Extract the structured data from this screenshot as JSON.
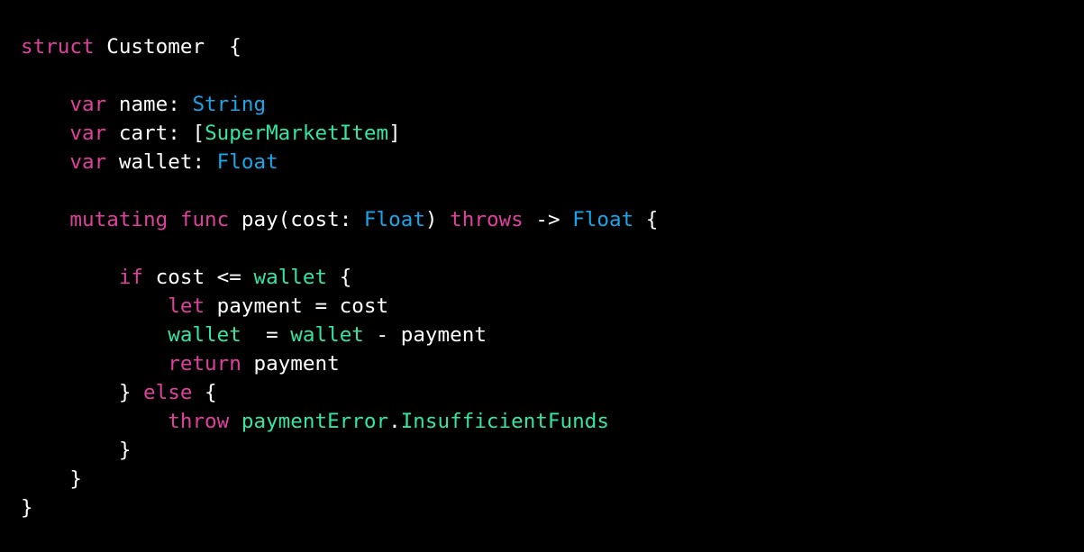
{
  "colors": {
    "keyword": "#e0409d",
    "type": "#17a6ea",
    "identifier": "#33e6a3",
    "plain": "#ffffff",
    "background": "#000000"
  },
  "code": {
    "lines": [
      [
        {
          "t": "struct",
          "c": "kw"
        },
        {
          "t": " Customer  {",
          "c": "plain"
        }
      ],
      [],
      [
        {
          "t": "    ",
          "c": "plain"
        },
        {
          "t": "var",
          "c": "kw"
        },
        {
          "t": " name: ",
          "c": "plain"
        },
        {
          "t": "String",
          "c": "type"
        }
      ],
      [
        {
          "t": "    ",
          "c": "plain"
        },
        {
          "t": "var",
          "c": "kw"
        },
        {
          "t": " cart: [",
          "c": "plain"
        },
        {
          "t": "SuperMarketItem",
          "c": "ident"
        },
        {
          "t": "]",
          "c": "plain"
        }
      ],
      [
        {
          "t": "    ",
          "c": "plain"
        },
        {
          "t": "var",
          "c": "kw"
        },
        {
          "t": " wallet: ",
          "c": "plain"
        },
        {
          "t": "Float",
          "c": "type"
        }
      ],
      [],
      [
        {
          "t": "    ",
          "c": "plain"
        },
        {
          "t": "mutating func",
          "c": "kw"
        },
        {
          "t": " pay(cost: ",
          "c": "plain"
        },
        {
          "t": "Float",
          "c": "type"
        },
        {
          "t": ") ",
          "c": "plain"
        },
        {
          "t": "throws",
          "c": "kw"
        },
        {
          "t": " -> ",
          "c": "plain"
        },
        {
          "t": "Float",
          "c": "type"
        },
        {
          "t": " {",
          "c": "plain"
        }
      ],
      [],
      [
        {
          "t": "        ",
          "c": "plain"
        },
        {
          "t": "if",
          "c": "kw"
        },
        {
          "t": " cost <= ",
          "c": "plain"
        },
        {
          "t": "wallet",
          "c": "ident"
        },
        {
          "t": " {",
          "c": "plain"
        }
      ],
      [
        {
          "t": "            ",
          "c": "plain"
        },
        {
          "t": "let",
          "c": "kw"
        },
        {
          "t": " payment = cost",
          "c": "plain"
        }
      ],
      [
        {
          "t": "            ",
          "c": "plain"
        },
        {
          "t": "wallet",
          "c": "ident"
        },
        {
          "t": "  = ",
          "c": "plain"
        },
        {
          "t": "wallet",
          "c": "ident"
        },
        {
          "t": " - payment",
          "c": "plain"
        }
      ],
      [
        {
          "t": "            ",
          "c": "plain"
        },
        {
          "t": "return",
          "c": "kw"
        },
        {
          "t": " payment",
          "c": "plain"
        }
      ],
      [
        {
          "t": "        } ",
          "c": "plain"
        },
        {
          "t": "else",
          "c": "kw"
        },
        {
          "t": " {",
          "c": "plain"
        }
      ],
      [
        {
          "t": "            ",
          "c": "plain"
        },
        {
          "t": "throw",
          "c": "kw"
        },
        {
          "t": " ",
          "c": "plain"
        },
        {
          "t": "paymentError",
          "c": "ident"
        },
        {
          "t": ".",
          "c": "plain"
        },
        {
          "t": "InsufficientFunds",
          "c": "ident"
        }
      ],
      [
        {
          "t": "        }",
          "c": "plain"
        }
      ],
      [
        {
          "t": "    }",
          "c": "plain"
        }
      ],
      [
        {
          "t": "}",
          "c": "plain"
        }
      ]
    ]
  }
}
